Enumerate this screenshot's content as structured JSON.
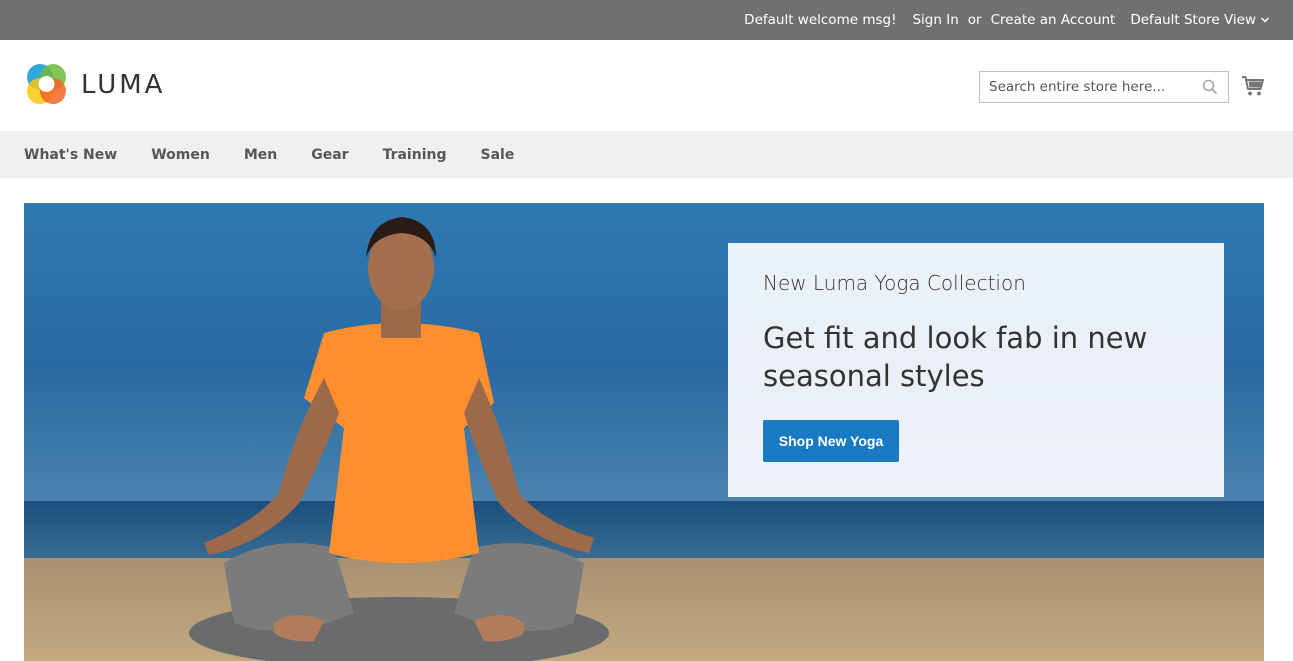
{
  "topbar": {
    "welcome": "Default welcome msg!",
    "sign_in": "Sign In",
    "or": "or",
    "create_account": "Create an Account",
    "store_view": "Default Store View"
  },
  "header": {
    "logo_text": "LUMA",
    "search_placeholder": "Search entire store here...",
    "search_value": ""
  },
  "nav": {
    "items": [
      "What's New",
      "Women",
      "Men",
      "Gear",
      "Training",
      "Sale"
    ]
  },
  "hero": {
    "subtitle": "New Luma Yoga Collection",
    "title": "Get fit and look fab in new seasonal styles",
    "button": "Shop New Yoga"
  },
  "colors": {
    "topbar_bg": "#6e716e",
    "nav_bg": "#f0f0f0",
    "button_blue": "#1979c3",
    "sky": "#2a6fa8",
    "sand": "#b39874",
    "shirt": "#ff8f2e"
  },
  "icons": {
    "store_dropdown": "chevron-down-icon",
    "search": "search-icon",
    "cart": "cart-icon",
    "logo": "luma-logo-icon"
  }
}
